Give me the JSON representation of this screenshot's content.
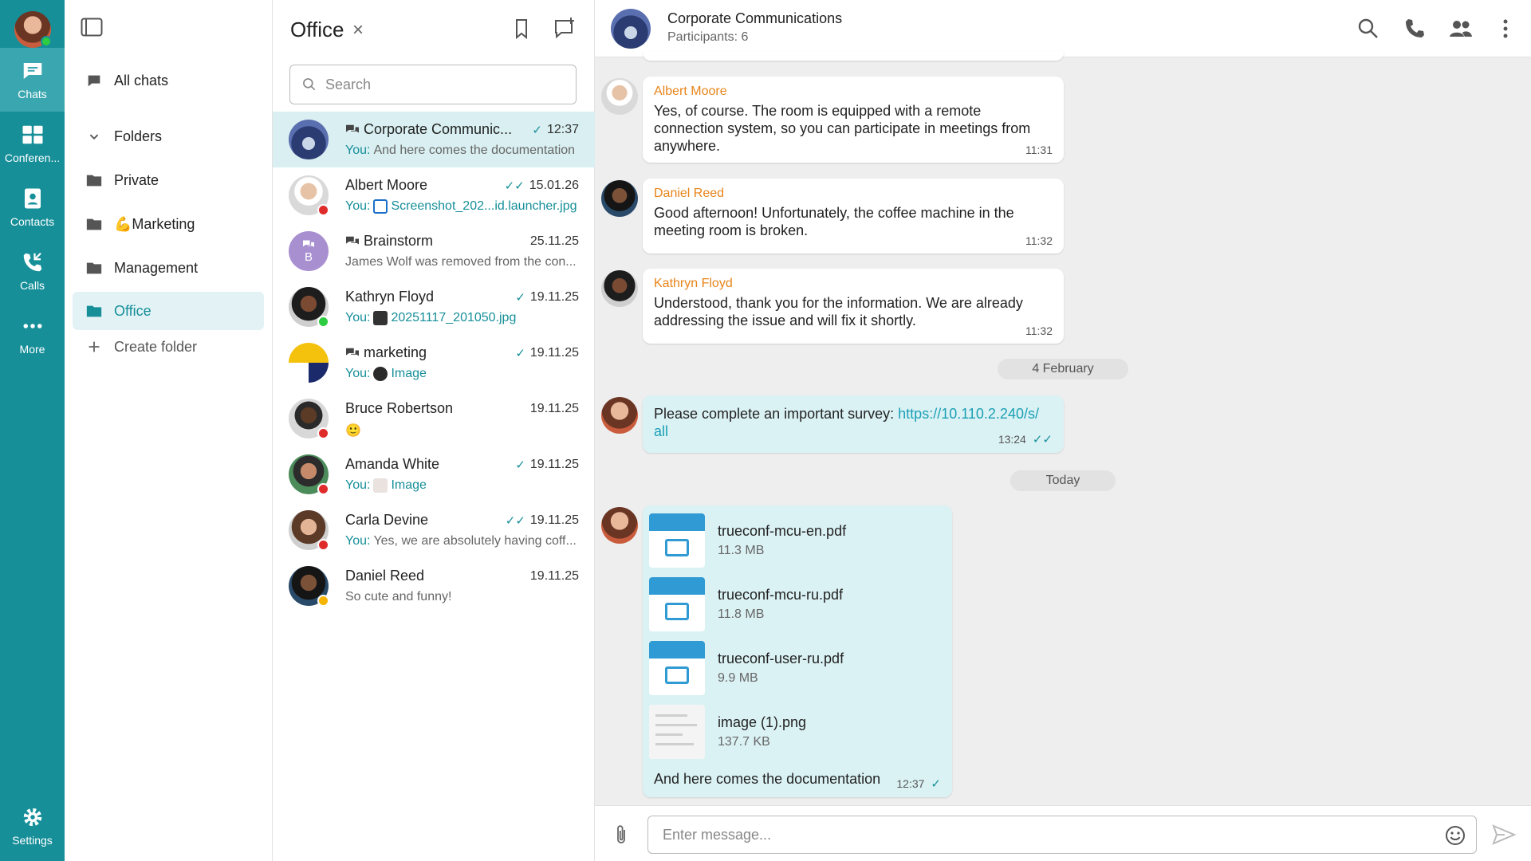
{
  "rail": {
    "items": [
      {
        "label": "Chats",
        "icon": "chat-bubble-icon",
        "active": true
      },
      {
        "label": "Conferen...",
        "icon": "conference-icon"
      },
      {
        "label": "Contacts",
        "icon": "contacts-icon"
      },
      {
        "label": "Calls",
        "icon": "calls-icon"
      },
      {
        "label": "More",
        "icon": "more-dots-icon"
      }
    ],
    "settings_label": "Settings"
  },
  "folders": {
    "all_chats": "All chats",
    "folders_label": "Folders",
    "items": [
      {
        "label": "Private"
      },
      {
        "label": "💪Marketing"
      },
      {
        "label": "Management"
      },
      {
        "label": "Office",
        "active": true
      }
    ],
    "create": "Create folder"
  },
  "list": {
    "title": "Office",
    "close": "×",
    "search_placeholder": "Search",
    "chats": [
      {
        "name": "Corporate Communic...",
        "time": "12:37",
        "check": "✓",
        "prefix": "You:",
        "preview": "And here comes the documentation",
        "group": true,
        "active": true
      },
      {
        "name": "Albert Moore",
        "time": "15.01.26",
        "check": "✓✓",
        "prefix": "You:",
        "preview": "Screenshot_202...id.launcher.jpg",
        "preview_link": true
      },
      {
        "name": "Brainstorm",
        "time": "25.11.25",
        "check": "",
        "prefix": "",
        "preview": "James Wolf was removed from the con...",
        "group": true,
        "initial": "B"
      },
      {
        "name": "Kathryn Floyd",
        "time": "19.11.25",
        "check": "✓",
        "prefix": "You:",
        "preview": "20251117_201050.jpg",
        "preview_link": true
      },
      {
        "name": "marketing",
        "time": "19.11.25",
        "check": "✓",
        "prefix": "You:",
        "preview": "Image",
        "preview_link": true,
        "group": true
      },
      {
        "name": "Bruce Robertson",
        "time": "19.11.25",
        "check": "",
        "prefix": "",
        "preview": "🙂"
      },
      {
        "name": "Amanda White",
        "time": "19.11.25",
        "check": "✓",
        "prefix": "You:",
        "preview": "Image",
        "preview_link": true
      },
      {
        "name": "Carla Devine",
        "time": "19.11.25",
        "check": "✓✓",
        "prefix": "You:",
        "preview": "Yes, we are absolutely having coff..."
      },
      {
        "name": "Daniel Reed",
        "time": "19.11.25",
        "check": "",
        "prefix": "",
        "preview": "So cute and funny!"
      }
    ]
  },
  "conversation": {
    "title": "Corporate Communications",
    "subtitle": "Participants: 6",
    "messages": [
      {
        "author": "Albert Moore",
        "text": "Yes, of course. The room is equipped with a remote connection system, so you can participate in meetings from anywhere.",
        "time": "11:31"
      },
      {
        "author": "Daniel Reed",
        "text": "Good afternoon! Unfortunately, the coffee machine in the meeting room is broken.",
        "time": "11:32"
      },
      {
        "author": "Kathryn Floyd",
        "text": "Understood, thank you for the information. We are already addressing the issue and will fix it shortly.",
        "time": "11:32"
      }
    ],
    "sep1": "4 February",
    "survey": {
      "text": "Please complete an important survey:",
      "link": "https://10.110.2.240/s/all",
      "link_line1": "https://10.110.2.240/s/",
      "link_line2": "all",
      "time": "13:24",
      "check": "✓✓"
    },
    "sep2": "Today",
    "files": [
      {
        "name": "trueconf-mcu-en.pdf",
        "size": "11.3 MB"
      },
      {
        "name": "trueconf-mcu-ru.pdf",
        "size": "11.8 MB"
      },
      {
        "name": "trueconf-user-ru.pdf",
        "size": "9.9 MB"
      },
      {
        "name": "image (1).png",
        "size": "137.7 KB"
      }
    ],
    "files_caption": "And here comes the documentation",
    "files_time": "12:37",
    "files_check": "✓"
  },
  "composer": {
    "placeholder": "Enter message..."
  },
  "colors": {
    "accent": "#168f99",
    "author": "#e8841a",
    "link": "#1a9fb4"
  }
}
